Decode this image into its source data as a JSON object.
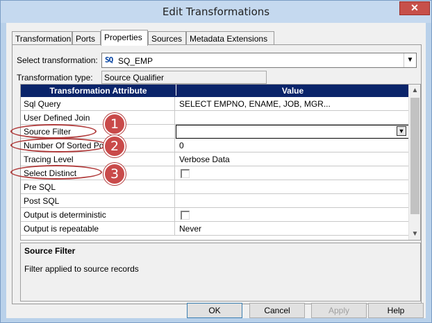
{
  "window": {
    "title": "Edit Transformations",
    "close_glyph": "✕"
  },
  "tabs": [
    "Transformation",
    "Ports",
    "Properties",
    "Sources",
    "Metadata Extensions"
  ],
  "active_tab": "Properties",
  "select_transformation": {
    "label": "Select transformation:",
    "icon_text": "SQ",
    "value": "SQ_EMP"
  },
  "transformation_type": {
    "label": "Transformation type:",
    "value": "Source Qualifier"
  },
  "grid": {
    "headers": [
      "Transformation Attribute",
      "Value"
    ],
    "rows": [
      {
        "attribute": "Sql Query",
        "value": "SELECT  EMPNO,  ENAME, JOB, MGR..."
      },
      {
        "attribute": "User Defined Join",
        "value": ""
      },
      {
        "attribute": "Source Filter",
        "value": ""
      },
      {
        "attribute": "Number Of Sorted Ports",
        "value": "0"
      },
      {
        "attribute": "Tracing Level",
        "value": "Verbose Data"
      },
      {
        "attribute": "Select Distinct",
        "value": ""
      },
      {
        "attribute": "Pre SQL",
        "value": ""
      },
      {
        "attribute": "Post SQL",
        "value": ""
      },
      {
        "attribute": "Output is deterministic",
        "value": ""
      },
      {
        "attribute": "Output is repeatable",
        "value": "Never"
      }
    ]
  },
  "description": {
    "title": "Source Filter",
    "text": "Filter applied to source records"
  },
  "buttons": {
    "ok": "OK",
    "cancel": "Cancel",
    "apply": "Apply",
    "help": "Help"
  },
  "callouts": [
    "1",
    "2",
    "3"
  ],
  "colors": {
    "header_bg": "#0a246a",
    "callout": "#c94a4a",
    "title_bar": "#c5d9ef"
  }
}
